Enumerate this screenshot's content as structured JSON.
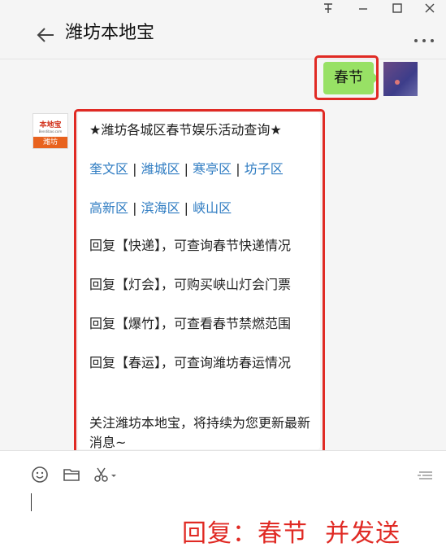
{
  "window": {
    "pin_icon": "pin-icon",
    "minimize_icon": "minimize-icon",
    "maximize_icon": "maximize-icon",
    "close_icon": "close-icon"
  },
  "header": {
    "title": "潍坊本地宝",
    "back_icon": "back-arrow-icon",
    "more_icon": "more-dots-icon"
  },
  "chat": {
    "my_message": "春节",
    "bot_avatar": {
      "brand": "本地宝",
      "domain": "Bendibao.com",
      "city": "潍坊"
    },
    "reply": {
      "title": "★潍坊各城区春节娱乐活动查询★",
      "districts_row1": [
        "奎文区",
        "潍城区",
        "寒亭区",
        "坊子区"
      ],
      "districts_row2": [
        "高新区",
        "滨海区",
        "峡山区"
      ],
      "separator": " | ",
      "lines": [
        "回复【快递】，可查询春节快递情况",
        "回复【灯会】，可购买峡山灯会门票",
        "回复【爆竹】，可查看春节禁燃范围",
        "回复【春运】，可查询潍坊春运情况"
      ],
      "footer": "关注潍坊本地宝，将持续为您更新最新消息~"
    }
  },
  "toolbar": {
    "emoji_icon": "emoji-icon",
    "folder_icon": "folder-icon",
    "screenshot_icon": "scissors-icon",
    "history_icon": "chat-history-icon"
  },
  "annotation": "回复：春节  并发送",
  "colors": {
    "bubble_green": "#98e165",
    "link_blue": "#2f7cc2",
    "highlight_red": "#e02a24",
    "brand_orange": "#e8621e"
  }
}
